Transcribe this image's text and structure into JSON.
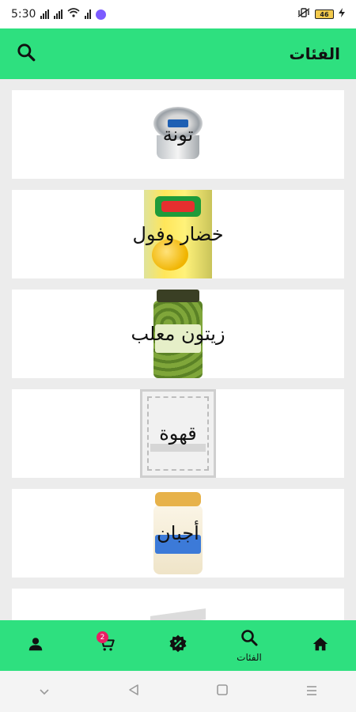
{
  "status_bar": {
    "time": "5:30",
    "battery": "46"
  },
  "app_bar": {
    "title": "الفئات"
  },
  "categories": [
    {
      "label": "تونة",
      "image": "tuna-can"
    },
    {
      "label": "خضار وفول",
      "image": "corn-can"
    },
    {
      "label": "زيتون معلب",
      "image": "olive-jar"
    },
    {
      "label": "قهوة",
      "image": "coffee-bag"
    },
    {
      "label": "أجبان",
      "image": "cheese-jar"
    },
    {
      "label": "",
      "image": "partial-item"
    }
  ],
  "bottom_nav": {
    "items": [
      {
        "name": "profile",
        "label": ""
      },
      {
        "name": "cart",
        "label": "",
        "badge": "2"
      },
      {
        "name": "offers",
        "label": ""
      },
      {
        "name": "categories",
        "label": "الفئات"
      },
      {
        "name": "home",
        "label": ""
      }
    ]
  },
  "colors": {
    "accent": "#2ee07f",
    "badge": "#e91e63",
    "card": "#ffffff",
    "background": "#ececec"
  }
}
